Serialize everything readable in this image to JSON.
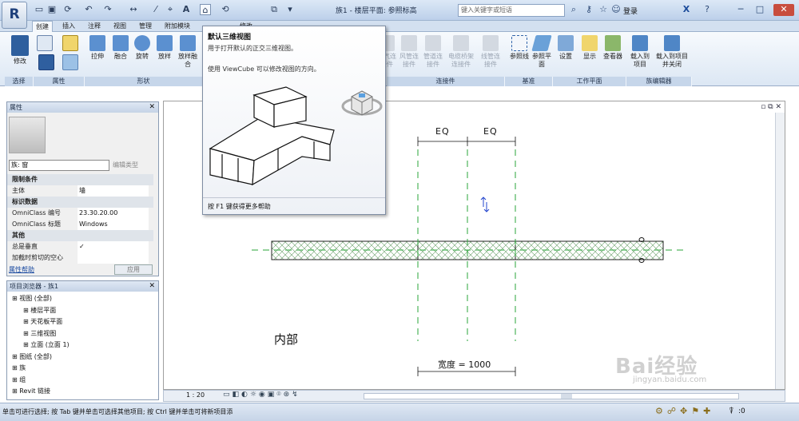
{
  "titlebar": {
    "app_letter": "R",
    "title": "族1 - 楼层平面: 参照标高",
    "search_placeholder": "键入关键字或短语",
    "login": "登录"
  },
  "tabs": [
    "创建",
    "插入",
    "注释",
    "视图",
    "管理",
    "附加模块",
    "修改"
  ],
  "active_tab": "创建",
  "ribbon": {
    "modify": "修改",
    "select": "选择",
    "properties_panel": "属性",
    "form_buttons": [
      "拉伸",
      "融合",
      "旋转",
      "放样",
      "放样融合"
    ],
    "form_panel": "形状",
    "connector_buttons": [
      "电气连接件",
      "风管连接件",
      "管道连接件",
      "电缆桥架连接件",
      "线管连接件"
    ],
    "connector_panel": "连接件",
    "datum_buttons": [
      "参照线",
      "参照平面"
    ],
    "datum_panel": "基准",
    "workplane_buttons": [
      "设置",
      "显示",
      "查看器"
    ],
    "workplane_panel": "工作平面",
    "editor_buttons": [
      "载入到项目",
      "载入到项目并关闭"
    ],
    "editor_panel": "族编辑器"
  },
  "tooltip": {
    "title": "默认三维视图",
    "desc": "用于打开默认的正交三维视图。",
    "desc2": "使用 ViewCube 可以修改视图的方向。",
    "footer": "按 F1 键获得更多帮助"
  },
  "properties": {
    "header": "属性",
    "family": "族: 窗",
    "edit_type": "编辑类型",
    "rows": [
      {
        "k": "限制条件",
        "v": "",
        "sec": true
      },
      {
        "k": "主体",
        "v": "墙"
      },
      {
        "k": "标识数据",
        "v": "",
        "sec": true
      },
      {
        "k": "OmniClass 编号",
        "v": "23.30.20.00"
      },
      {
        "k": "OmniClass 标题",
        "v": "Windows"
      },
      {
        "k": "其他",
        "v": "",
        "sec": true
      },
      {
        "k": "总是垂直",
        "v": "✓"
      },
      {
        "k": "加截时剪切的空心",
        "v": ""
      }
    ],
    "help": "属性帮助",
    "apply": "应用"
  },
  "browser": {
    "header": "项目浏览器 - 族1",
    "items": [
      {
        "t": "视图 (全部)",
        "d": 0
      },
      {
        "t": "楼层平面",
        "d": 1
      },
      {
        "t": "天花板平面",
        "d": 1
      },
      {
        "t": "三维视图",
        "d": 1
      },
      {
        "t": "立面 (立面 1)",
        "d": 1
      },
      {
        "t": "图纸 (全部)",
        "d": 0
      },
      {
        "t": "族",
        "d": 0
      },
      {
        "t": "组",
        "d": 0
      },
      {
        "t": "Revit 链接",
        "d": 0
      }
    ]
  },
  "drawing": {
    "eq1": "EQ",
    "eq2": "EQ",
    "inside": "内部",
    "width_label": "宽度 = 1000"
  },
  "viewbar": {
    "scale": "1 : 20"
  },
  "status": {
    "text": "单击可进行选择; 按 Tab 键并单击可选择其他项目; 按 Ctrl 键并单击可将新项目添",
    "filter": ":0"
  },
  "watermark": {
    "line1": "Bai经验",
    "line2": "jingyan.baidu.com"
  },
  "colors": {
    "accent": "#1d3f7a",
    "ribbon_bg": "#dce7f4",
    "dashed": "#2aa63a"
  }
}
